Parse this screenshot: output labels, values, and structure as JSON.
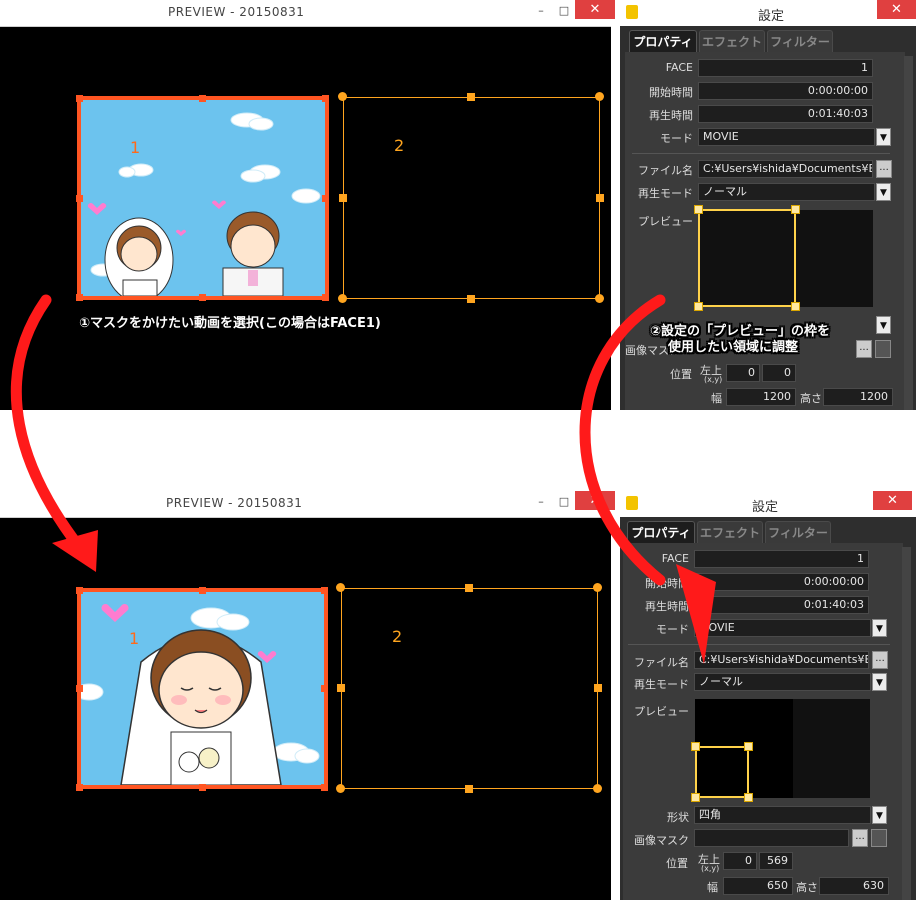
{
  "preview_window": {
    "title": "PREVIEW - 20150831",
    "minimize": "–",
    "maximize": "□",
    "close": "✕",
    "face1_label": "1",
    "face2_label": "2"
  },
  "settings_window": {
    "title": "設定",
    "tabs": [
      "プロパティ",
      "エフェクト",
      "フィルター"
    ],
    "face_label": "FACE",
    "face_value": "1",
    "start_label": "開始時間",
    "start_value": "0:00:00:00",
    "play_label": "再生時間",
    "play_value": "0:01:40:03",
    "mode_label": "モード",
    "mode_value": "MOVIE",
    "file_label": "ファイル名",
    "file_value": "C:¥Users¥ishida¥Documents¥Brid",
    "play_mode_label": "再生モード",
    "play_mode_value": "ノーマル",
    "preview_label": "プレビュー",
    "shape_label": "形状",
    "shape_value": "四角",
    "mask_label": "画像マスク",
    "pos_label": "位置",
    "topleft_label": "左上",
    "xy_label": "(x,y)",
    "width_label": "幅",
    "height_label": "高さ",
    "dots": "...",
    "dropdown": "▼"
  },
  "top": {
    "pos_x": "0",
    "pos_y": "0",
    "width": "1200",
    "height": "1200"
  },
  "bottom": {
    "pos_x": "0",
    "pos_y": "569",
    "width": "650",
    "height": "630"
  },
  "annotations": {
    "step1": "①マスクをかけたい動画を選択(この場合はFACE1)",
    "step2_line1": "②設定の「プレビュー」の枠を",
    "step2_line2": "使用したい領域に調整"
  },
  "colors": {
    "selection": "#ff5522",
    "face2_frame": "#ffa51f",
    "preview_handle": "#ffd24a",
    "arrow": "#ff1a1a"
  }
}
